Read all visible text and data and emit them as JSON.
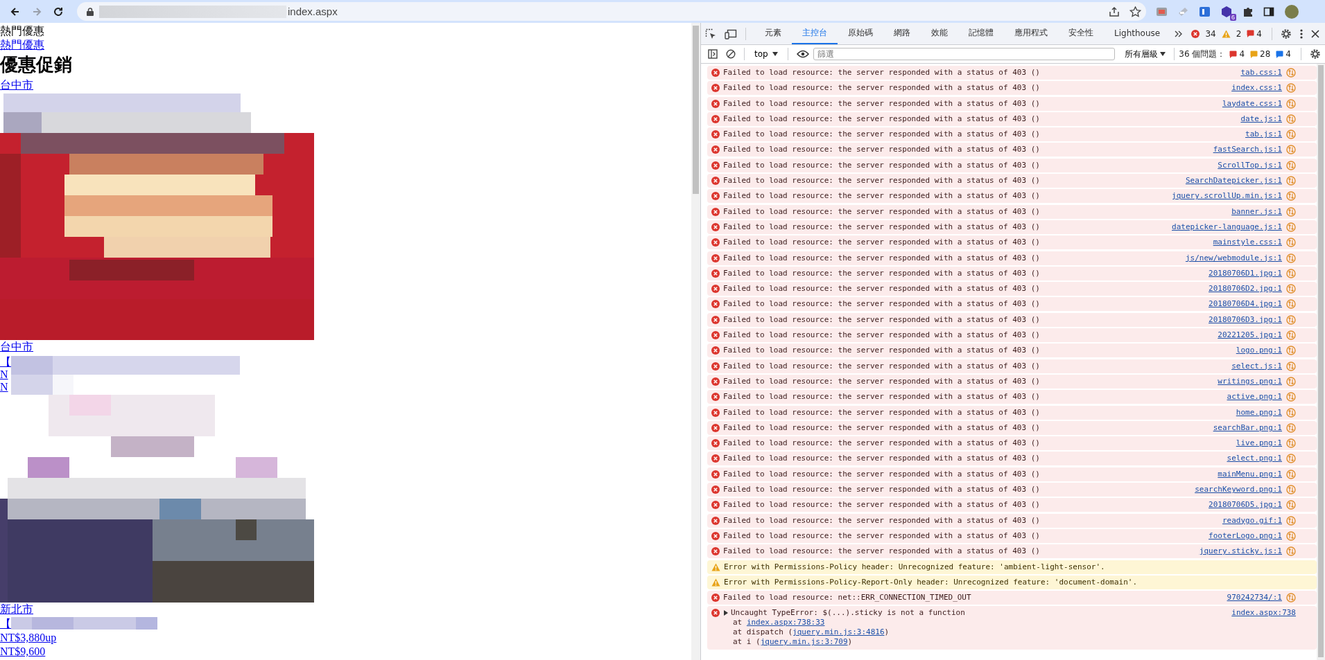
{
  "browser": {
    "nav": [
      {
        "kind": "back",
        "disabled": false
      },
      {
        "kind": "forward",
        "disabled": true
      },
      {
        "kind": "reload",
        "disabled": false
      }
    ],
    "url": "index.aspx",
    "extension_badge": "6"
  },
  "page": {
    "items": [
      {
        "kind": "text",
        "text": "熱門優惠"
      },
      {
        "kind": "link",
        "text": "熱門優惠"
      },
      {
        "kind": "heading",
        "text": "優惠促銷"
      },
      {
        "kind": "link",
        "text": "台中市"
      },
      {
        "kind": "picture"
      },
      {
        "kind": "link",
        "text": "台中市"
      },
      {
        "kind": "covered_links",
        "links": [
          "【",
          "N",
          "N"
        ]
      },
      {
        "kind": "picture"
      },
      {
        "kind": "link",
        "text": "新北市"
      },
      {
        "kind": "covered_link",
        "text": "【"
      },
      {
        "kind": "link",
        "text": "NT$3,880up"
      },
      {
        "kind": "link",
        "text": "NT$9,600"
      }
    ]
  },
  "devtools": {
    "tabs": [
      {
        "label": "元素",
        "selected": false
      },
      {
        "label": "主控台",
        "selected": true
      },
      {
        "label": "原始碼",
        "selected": false
      },
      {
        "label": "網路",
        "selected": false
      },
      {
        "label": "效能",
        "selected": false
      },
      {
        "label": "記憶體",
        "selected": false
      },
      {
        "label": "應用程式",
        "selected": false
      },
      {
        "label": "安全性",
        "selected": false
      },
      {
        "label": "Lighthouse",
        "selected": false
      }
    ],
    "counts": {
      "errors": "34",
      "warnings": "2",
      "issues": "4"
    },
    "toolbar": {
      "context": "top",
      "filter_placeholder": "篩選",
      "levels": "所有層級",
      "issues_label": "36 個問題：",
      "issue_counts": [
        {
          "kind": "error",
          "count": "4"
        },
        {
          "kind": "warning",
          "count": "28"
        },
        {
          "kind": "info",
          "count": "4"
        }
      ]
    },
    "messages": [
      {
        "kind": "error",
        "message": "Failed to load resource: the server responded with a status of 403 ()",
        "source": "tab.css:1",
        "network": true
      },
      {
        "kind": "error",
        "message": "Failed to load resource: the server responded with a status of 403 ()",
        "source": "index.css:1",
        "network": true
      },
      {
        "kind": "error",
        "message": "Failed to load resource: the server responded with a status of 403 ()",
        "source": "laydate.css:1",
        "network": true
      },
      {
        "kind": "error",
        "message": "Failed to load resource: the server responded with a status of 403 ()",
        "source": "date.js:1",
        "network": true
      },
      {
        "kind": "error",
        "message": "Failed to load resource: the server responded with a status of 403 ()",
        "source": "tab.js:1",
        "network": true
      },
      {
        "kind": "error",
        "message": "Failed to load resource: the server responded with a status of 403 ()",
        "source": "fastSearch.js:1",
        "network": true
      },
      {
        "kind": "error",
        "message": "Failed to load resource: the server responded with a status of 403 ()",
        "source": "ScrollTop.js:1",
        "network": true
      },
      {
        "kind": "error",
        "message": "Failed to load resource: the server responded with a status of 403 ()",
        "source": "SearchDatepicker.js:1",
        "network": true
      },
      {
        "kind": "error",
        "message": "Failed to load resource: the server responded with a status of 403 ()",
        "source": "jquery.scrollUp.min.js:1",
        "network": true
      },
      {
        "kind": "error",
        "message": "Failed to load resource: the server responded with a status of 403 ()",
        "source": "banner.js:1",
        "network": true
      },
      {
        "kind": "error",
        "message": "Failed to load resource: the server responded with a status of 403 ()",
        "source": "datepicker-language.js:1",
        "network": true
      },
      {
        "kind": "error",
        "message": "Failed to load resource: the server responded with a status of 403 ()",
        "source": "mainstyle.css:1",
        "network": true
      },
      {
        "kind": "error",
        "message": "Failed to load resource: the server responded with a status of 403 ()",
        "source": "js/new/webmodule.js:1",
        "network": true
      },
      {
        "kind": "error",
        "message": "Failed to load resource: the server responded with a status of 403 ()",
        "source": "20180706D1.jpg:1",
        "network": true
      },
      {
        "kind": "error",
        "message": "Failed to load resource: the server responded with a status of 403 ()",
        "source": "20180706D2.jpg:1",
        "network": true
      },
      {
        "kind": "error",
        "message": "Failed to load resource: the server responded with a status of 403 ()",
        "source": "20180706D4.jpg:1",
        "network": true
      },
      {
        "kind": "error",
        "message": "Failed to load resource: the server responded with a status of 403 ()",
        "source": "20180706D3.jpg:1",
        "network": true
      },
      {
        "kind": "error",
        "message": "Failed to load resource: the server responded with a status of 403 ()",
        "source": "20221205.jpg:1",
        "network": true
      },
      {
        "kind": "error",
        "message": "Failed to load resource: the server responded with a status of 403 ()",
        "source": "logo.png:1",
        "network": true
      },
      {
        "kind": "error",
        "message": "Failed to load resource: the server responded with a status of 403 ()",
        "source": "select.js:1",
        "network": true
      },
      {
        "kind": "error",
        "message": "Failed to load resource: the server responded with a status of 403 ()",
        "source": "writings.png:1",
        "network": true
      },
      {
        "kind": "error",
        "message": "Failed to load resource: the server responded with a status of 403 ()",
        "source": "active.png:1",
        "network": true
      },
      {
        "kind": "error",
        "message": "Failed to load resource: the server responded with a status of 403 ()",
        "source": "home.png:1",
        "network": true
      },
      {
        "kind": "error",
        "message": "Failed to load resource: the server responded with a status of 403 ()",
        "source": "searchBar.png:1",
        "network": true
      },
      {
        "kind": "error",
        "message": "Failed to load resource: the server responded with a status of 403 ()",
        "source": "live.png:1",
        "network": true
      },
      {
        "kind": "error",
        "message": "Failed to load resource: the server responded with a status of 403 ()",
        "source": "select.png:1",
        "network": true
      },
      {
        "kind": "error",
        "message": "Failed to load resource: the server responded with a status of 403 ()",
        "source": "mainMenu.png:1",
        "network": true
      },
      {
        "kind": "error",
        "message": "Failed to load resource: the server responded with a status of 403 ()",
        "source": "searchKeyword.png:1",
        "network": true
      },
      {
        "kind": "error",
        "message": "Failed to load resource: the server responded with a status of 403 ()",
        "source": "20180706D5.jpg:1",
        "network": true
      },
      {
        "kind": "error",
        "message": "Failed to load resource: the server responded with a status of 403 ()",
        "source": "readygo.gif:1",
        "network": true
      },
      {
        "kind": "error",
        "message": "Failed to load resource: the server responded with a status of 403 ()",
        "source": "footerLogo.png:1",
        "network": true
      },
      {
        "kind": "error",
        "message": "Failed to load resource: the server responded with a status of 403 ()",
        "source": "jquery.sticky.js:1",
        "network": true
      },
      {
        "kind": "warning",
        "message": "Error with Permissions-Policy header: Unrecognized feature: 'ambient-light-sensor'.",
        "network": false
      },
      {
        "kind": "warning",
        "message": "Error with Permissions-Policy-Report-Only header: Unrecognized feature: 'document-domain'.",
        "network": false
      },
      {
        "kind": "error",
        "message": "Failed to load resource: net::ERR_CONNECTION_TIMED_OUT",
        "source": "970242734/:1",
        "network": true
      },
      {
        "kind": "error",
        "message": "Uncaught TypeError: $(...).sticky is not a function",
        "source": "index.aspx:738",
        "network": false,
        "expanded": false,
        "stack": [
          {
            "prefix": "at ",
            "link": "index.aspx:738:33"
          },
          {
            "prefix": "at dispatch (",
            "link": "jquery.min.js:3:4816",
            "suffix": ")"
          },
          {
            "prefix": "at i (",
            "link": "jquery.min.js:3:709",
            "suffix": ")"
          }
        ]
      }
    ]
  }
}
